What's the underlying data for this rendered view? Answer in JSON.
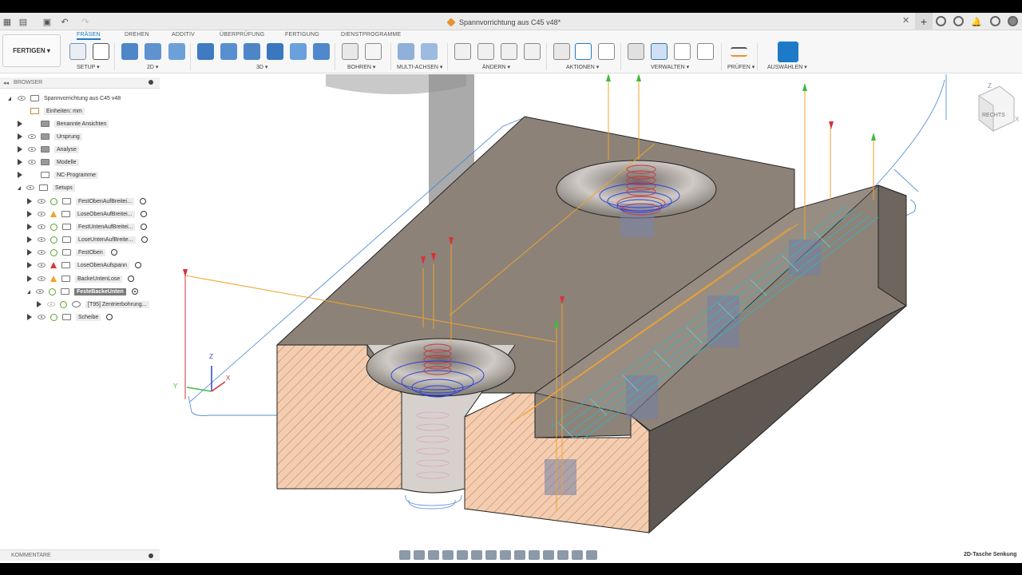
{
  "window": {
    "document_title": "Spannvorrichtung aus C45 v48*"
  },
  "ribbon": {
    "workspace_label": "FERTIGEN ▾",
    "tabs": [
      "FRÄSEN",
      "DREHEN",
      "ADDITIV",
      "ÜBERPRÜFUNG",
      "FERTIGUNG",
      "DIENSTPROGRAMME"
    ],
    "groups": [
      "SETUP ▾",
      "2D ▾",
      "3D ▾",
      "BOHREN ▾",
      "MULTI-ACHSEN ▾",
      "ÄNDERN ▾",
      "AKTIONEN ▾",
      "VERWALTEN ▾",
      "PRÜFEN ▾",
      "AUSWÄHLEN ▾"
    ],
    "accent_color": "#1d7ac7"
  },
  "browser": {
    "header": "BROWSER",
    "root": "Spannvorrichtung aus C45 v48",
    "units": "Einheiten: mm",
    "nodes": [
      "Benannte Ansichten",
      "Ursprung",
      "Analyse",
      "Modelle",
      "NC-Programme",
      "Setups"
    ],
    "setups": [
      {
        "label": "FestObenAufBreitei...",
        "status": "ok"
      },
      {
        "label": "LoseObenAufBreitei...",
        "status": "warning"
      },
      {
        "label": "FestUntenAufBreitei...",
        "status": "ok"
      },
      {
        "label": "LoseUntenAufBreite...",
        "status": "ok"
      },
      {
        "label": "FestOben",
        "status": "ok"
      },
      {
        "label": "LoseObenAufspann",
        "status": "error"
      },
      {
        "label": "BackeUntenLose",
        "status": "warning"
      },
      {
        "label": "FesteBackeUnten",
        "status": "ok"
      },
      {
        "label": "Scheibe",
        "status": "ok"
      }
    ],
    "operation": "[T95] Zentrierbohrung..."
  },
  "comments_label": "KOMMENTARE",
  "viewcube": {
    "face_label": "RECHTS",
    "axis_z": "Z",
    "axis_x": "X"
  },
  "triad": {
    "z": "Z",
    "y": "Y",
    "x": "X"
  },
  "status_operation": "2D-Tasche Senkung",
  "colors": {
    "part_top": "#8e8479",
    "part_section": "#f2c9a8",
    "toolpath_rapid": "#f0a32d",
    "toolpath_cut": "#2a6fe0",
    "toolpath_lead": "#d8323a"
  }
}
